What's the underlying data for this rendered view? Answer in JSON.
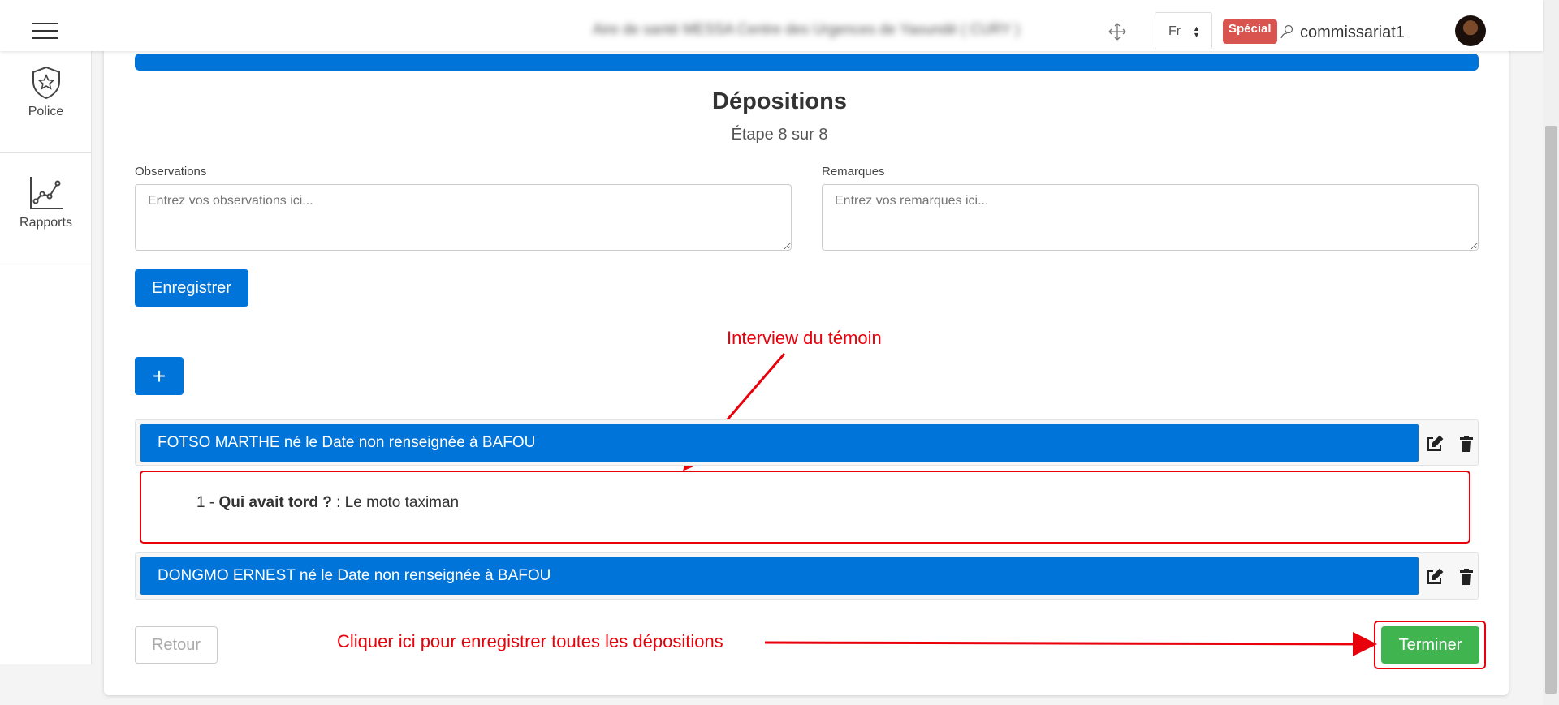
{
  "header": {
    "center_title": "Aire de santé MESSA Centre des Urgences de Yaoundé ( CURY )",
    "language": "Fr",
    "badge": "Spécial",
    "username": "commissariat1"
  },
  "sidebar": {
    "items": [
      {
        "label": "Police",
        "icon": "shield-star-icon"
      },
      {
        "label": "Rapports",
        "icon": "line-chart-icon"
      }
    ]
  },
  "page": {
    "title": "Dépositions",
    "step": "Étape 8 sur 8"
  },
  "form": {
    "observations_label": "Observations",
    "observations_placeholder": "Entrez vos observations ici...",
    "remarques_label": "Remarques",
    "remarques_placeholder": "Entrez vos remarques ici...",
    "save_label": "Enregistrer",
    "add_label": "+"
  },
  "depositions": [
    {
      "header": "FOTSO MARTHE né le Date non renseignée à BAFOU",
      "answers": [
        {
          "number": "1 -",
          "question": "Qui avait tord ?",
          "answer": " : Le moto taximan"
        }
      ]
    },
    {
      "header": "DONGMO ERNEST né le Date non renseignée à BAFOU",
      "answers": []
    }
  ],
  "annotations": {
    "interview": "Interview du témoin",
    "finish_hint": "Cliquer ici pour enregistrer toutes les dépositions"
  },
  "footer": {
    "back_label": "Retour",
    "finish_label": "Terminer"
  },
  "colors": {
    "primary": "#0174d9",
    "success": "#3fb44f",
    "danger": "#d9534f",
    "annotation": "#e8000b"
  }
}
